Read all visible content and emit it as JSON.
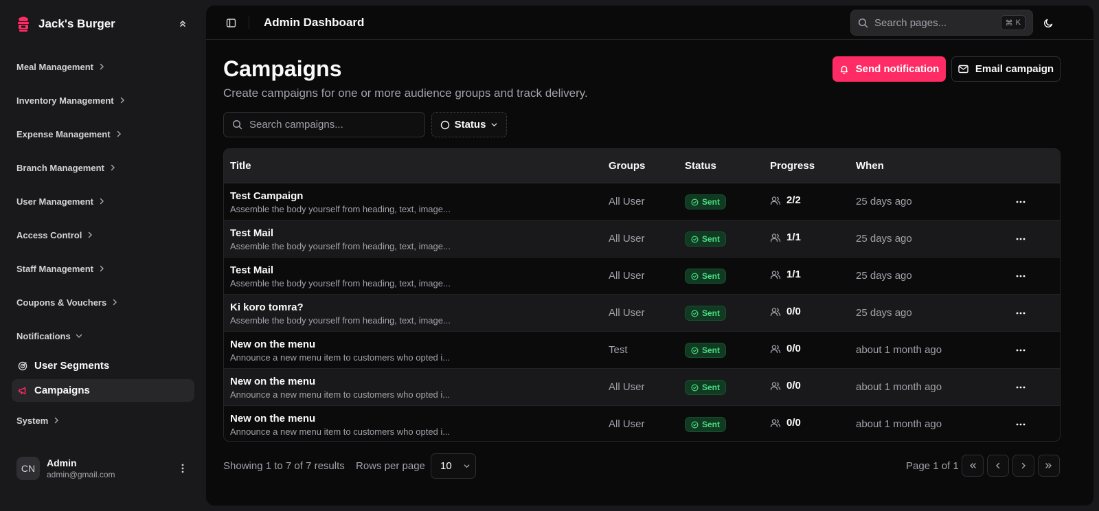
{
  "brand": {
    "name": "Jack's Burger",
    "logo_icon": "burger-logo-icon",
    "accent": "#ff2b64"
  },
  "sidebar": {
    "groups": [
      {
        "label": "Meal Management"
      },
      {
        "label": "Inventory Management"
      },
      {
        "label": "Expense Management"
      },
      {
        "label": "Branch Management"
      },
      {
        "label": "User Management"
      },
      {
        "label": "Access Control"
      },
      {
        "label": "Staff Management"
      },
      {
        "label": "Coupons & Vouchers"
      },
      {
        "label": "Notifications",
        "expanded": true
      },
      {
        "label": "System"
      }
    ],
    "notifications_items": [
      {
        "label": "User Segments",
        "icon": "target-icon"
      },
      {
        "label": "Campaigns",
        "icon": "megaphone-icon",
        "active": true
      }
    ],
    "user": {
      "initials": "CN",
      "name": "Admin",
      "email": "admin@gmail.com"
    }
  },
  "topbar": {
    "title": "Admin Dashboard",
    "search_placeholder": "Search pages...",
    "shortcut_symbol": "⌘",
    "shortcut_key": "K"
  },
  "page": {
    "title": "Campaigns",
    "subtitle": "Create campaigns for one or more audience groups and track delivery.",
    "send_notification_label": "Send notification",
    "email_campaign_label": "Email campaign",
    "search_placeholder": "Search campaigns...",
    "status_filter_label": "Status"
  },
  "table": {
    "columns": [
      "Title",
      "Groups",
      "Status",
      "Progress",
      "When"
    ],
    "rows": [
      {
        "title": "Test Campaign",
        "desc": "Assemble the body yourself from heading, text, image...",
        "group": "All User",
        "status": "Sent",
        "progress": "2/2",
        "when": "25 days ago"
      },
      {
        "title": "Test Mail",
        "desc": "Assemble the body yourself from heading, text, image...",
        "group": "All User",
        "status": "Sent",
        "progress": "1/1",
        "when": "25 days ago"
      },
      {
        "title": "Test Mail",
        "desc": "Assemble the body yourself from heading, text, image...",
        "group": "All User",
        "status": "Sent",
        "progress": "1/1",
        "when": "25 days ago"
      },
      {
        "title": "Ki koro tomra?",
        "desc": "Assemble the body yourself from heading, text, image...",
        "group": "All User",
        "status": "Sent",
        "progress": "0/0",
        "when": "25 days ago"
      },
      {
        "title": "New on the menu",
        "desc": "Announce a new menu item to customers who opted i...",
        "group": "Test",
        "status": "Sent",
        "progress": "0/0",
        "when": "about 1 month ago"
      },
      {
        "title": "New on the menu",
        "desc": "Announce a new menu item to customers who opted i...",
        "group": "All User",
        "status": "Sent",
        "progress": "0/0",
        "when": "about 1 month ago"
      },
      {
        "title": "New on the menu",
        "desc": "Announce a new menu item to customers who opted i...",
        "group": "All User",
        "status": "Sent",
        "progress": "0/0",
        "when": "about 1 month ago"
      }
    ],
    "status_color": "#4ade80"
  },
  "pagination": {
    "showing": "Showing 1 to 7 of 7 results",
    "rows_per_page_label": "Rows per page",
    "rows_per_page_value": "10",
    "page_info": "Page 1 of 1"
  }
}
